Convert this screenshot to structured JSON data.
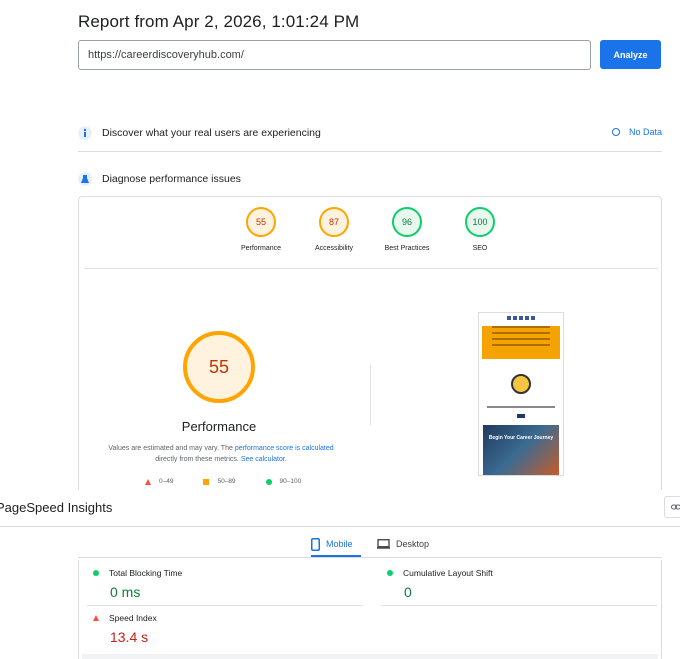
{
  "report": {
    "title": "Report from Apr 2, 2026, 1:01:24 PM",
    "url_value": "https://careerdiscoveryhub.com/",
    "analyze_label": "Analyze"
  },
  "crux": {
    "label": "Discover what your real users are experiencing",
    "status": "No Data"
  },
  "diagnose": {
    "label": "Diagnose performance issues"
  },
  "scores": [
    {
      "name": "Performance",
      "value": "55",
      "status": "average"
    },
    {
      "name": "Accessibility",
      "value": "87",
      "status": "average"
    },
    {
      "name": "Best Practices",
      "value": "96",
      "status": "good"
    },
    {
      "name": "SEO",
      "value": "100",
      "status": "good"
    }
  ],
  "performance_detail": {
    "score": "55",
    "label": "Performance",
    "note_prefix": "Values are estimated and may vary. The ",
    "note_link": "performance score is calculated",
    "note_mid": "directly from these metrics. ",
    "note_link2": "See calculator.",
    "legend": [
      {
        "shape": "triangle",
        "range": "0–49",
        "color": "#ff4e42"
      },
      {
        "shape": "square",
        "range": "50–89",
        "color": "#ffa400"
      },
      {
        "shape": "circle",
        "range": "90–100",
        "color": "#0cce6b"
      }
    ]
  },
  "screenshot_thumb": {
    "hero_text": "Begin Your Career Journey"
  },
  "psi": {
    "title": "PageSpeed Insights",
    "share_icon": "link-icon"
  },
  "tabs": {
    "mobile": "Mobile",
    "desktop": "Desktop",
    "selected": "Mobile"
  },
  "metrics": [
    {
      "name": "Total Blocking Time",
      "value": "0 ms",
      "status": "good"
    },
    {
      "name": "Cumulative Layout Shift",
      "value": "0",
      "status": "good"
    },
    {
      "name": "Speed Index",
      "value": "13.4 s",
      "status": "poor"
    }
  ],
  "colors": {
    "accent": "#1a73e8",
    "average": "#ffa400",
    "good": "#0cce6b",
    "poor": "#ff4e42"
  }
}
